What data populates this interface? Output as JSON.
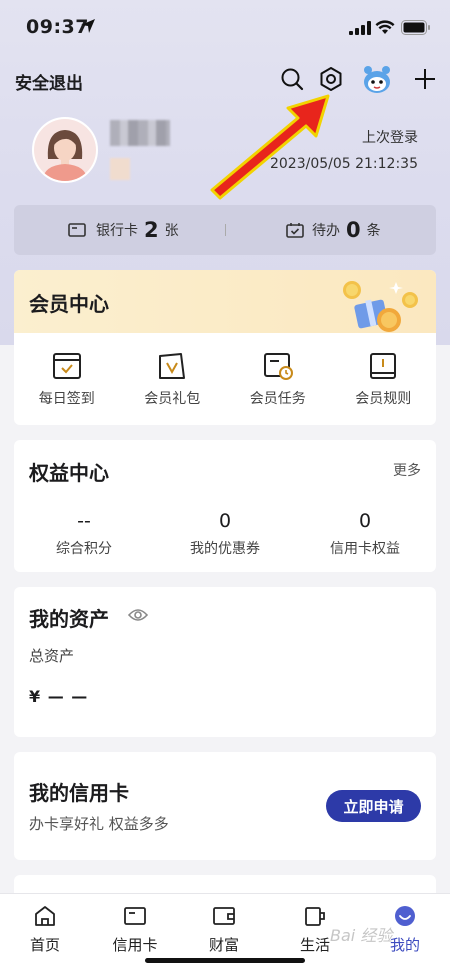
{
  "status_bar": {
    "time": "09:37"
  },
  "header": {
    "logout_label": "安全退出"
  },
  "profile": {
    "last_login_label": "上次登录",
    "last_login_time": "2023/05/05 21:12:35"
  },
  "counts": {
    "bank_card_label": "银行卡",
    "bank_card_count": "2",
    "bank_card_unit": "张",
    "todo_label": "待办",
    "todo_count": "0",
    "todo_unit": "条"
  },
  "member_center": {
    "title": "会员中心",
    "items": [
      {
        "label": "每日签到",
        "icon": "checkin-icon"
      },
      {
        "label": "会员礼包",
        "icon": "gift-pack-icon"
      },
      {
        "label": "会员任务",
        "icon": "task-icon"
      },
      {
        "label": "会员规则",
        "icon": "rules-book-icon"
      }
    ]
  },
  "rights_center": {
    "title": "权益中心",
    "more_label": "更多",
    "stats": [
      {
        "value": "--",
        "label": "综合积分"
      },
      {
        "value": "0",
        "label": "我的优惠券"
      },
      {
        "value": "0",
        "label": "信用卡权益"
      }
    ]
  },
  "assets": {
    "title": "我的资产",
    "total_label": "总资产",
    "total_value": "¥ — —"
  },
  "credit_card": {
    "title": "我的信用卡",
    "subtitle": "办卡享好礼 权益多多",
    "apply_label": "立即申请"
  },
  "tab_bar": {
    "tabs": [
      {
        "label": "首页",
        "icon": "home-icon"
      },
      {
        "label": "信用卡",
        "icon": "credit-card-icon"
      },
      {
        "label": "财富",
        "icon": "wallet-icon"
      },
      {
        "label": "生活",
        "icon": "cup-icon"
      },
      {
        "label": "我的",
        "icon": "profile-face-icon"
      }
    ],
    "active_index": 4
  },
  "watermark": "Bai 经验",
  "colors": {
    "accent": "#2d3aa8",
    "active_tab": "#3d4bbf",
    "annotation_arrow": "#e8251c"
  }
}
